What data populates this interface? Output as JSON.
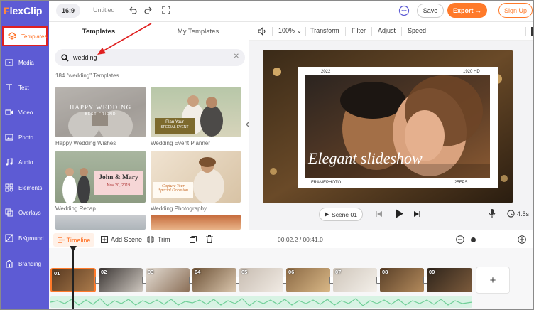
{
  "app": {
    "logo_prefix": "F",
    "logo_rest": "lexClip"
  },
  "sidebar": {
    "items": [
      {
        "label": "Templates",
        "icon": "layers-icon",
        "active": true
      },
      {
        "label": "Media",
        "icon": "media-icon"
      },
      {
        "label": "Text",
        "icon": "text-icon"
      },
      {
        "label": "Video",
        "icon": "video-icon"
      },
      {
        "label": "Photo",
        "icon": "photo-icon"
      },
      {
        "label": "Audio",
        "icon": "audio-icon"
      },
      {
        "label": "Elements",
        "icon": "elements-icon"
      },
      {
        "label": "Overlays",
        "icon": "overlays-icon"
      },
      {
        "label": "BKground",
        "icon": "background-icon"
      },
      {
        "label": "Branding",
        "icon": "branding-icon"
      }
    ]
  },
  "topbar": {
    "ratio": "16:9",
    "title": "Untitled",
    "save_label": "Save",
    "export_label": "Export →",
    "signup_label": "Sign Up"
  },
  "panel": {
    "tabs": [
      {
        "label": "Templates",
        "active": true
      },
      {
        "label": "My Templates"
      }
    ],
    "search_value": "wedding",
    "count_text": "184 \"wedding\" Templates",
    "templates": [
      {
        "caption": "Happy Wedding Wishes",
        "title_a": "HAPPY WEDDING",
        "title_b": "BEST FRIEND"
      },
      {
        "caption": "Wedding Event Planner",
        "title_a": "Plan Your",
        "title_b": "SPECIAL EVENT"
      },
      {
        "caption": "Wedding Recap",
        "title_a": "John & Mary",
        "title_b": "Nov 20, 2019"
      },
      {
        "caption": "Wedding Photography",
        "title_a": "Capture Your",
        "title_b": "Special Occasion"
      }
    ]
  },
  "preview": {
    "zoom": "100%",
    "tools": [
      "Transform",
      "Filter",
      "Adjust",
      "Speed"
    ],
    "canvas_year": "2022",
    "canvas_res": "1920 HD",
    "canvas_title": "Elegant slideshow",
    "canvas_brand": "FRAMEPHOTO",
    "canvas_fps": "25FPS",
    "scene_label": "Scene 01",
    "duration": "4.5s"
  },
  "timeline": {
    "timeline_label": "Timeline",
    "add_scene_label": "Add Scene",
    "trim_label": "Trim",
    "time_text": "00:02.2 / 00:41.0",
    "clips": [
      "01",
      "02",
      "03",
      "04",
      "05",
      "06",
      "07",
      "08",
      "09"
    ],
    "add_label": "+"
  },
  "colors": {
    "accent": "#5d5bd4",
    "orange": "#ff7a2a",
    "highlight": "#e02020"
  }
}
